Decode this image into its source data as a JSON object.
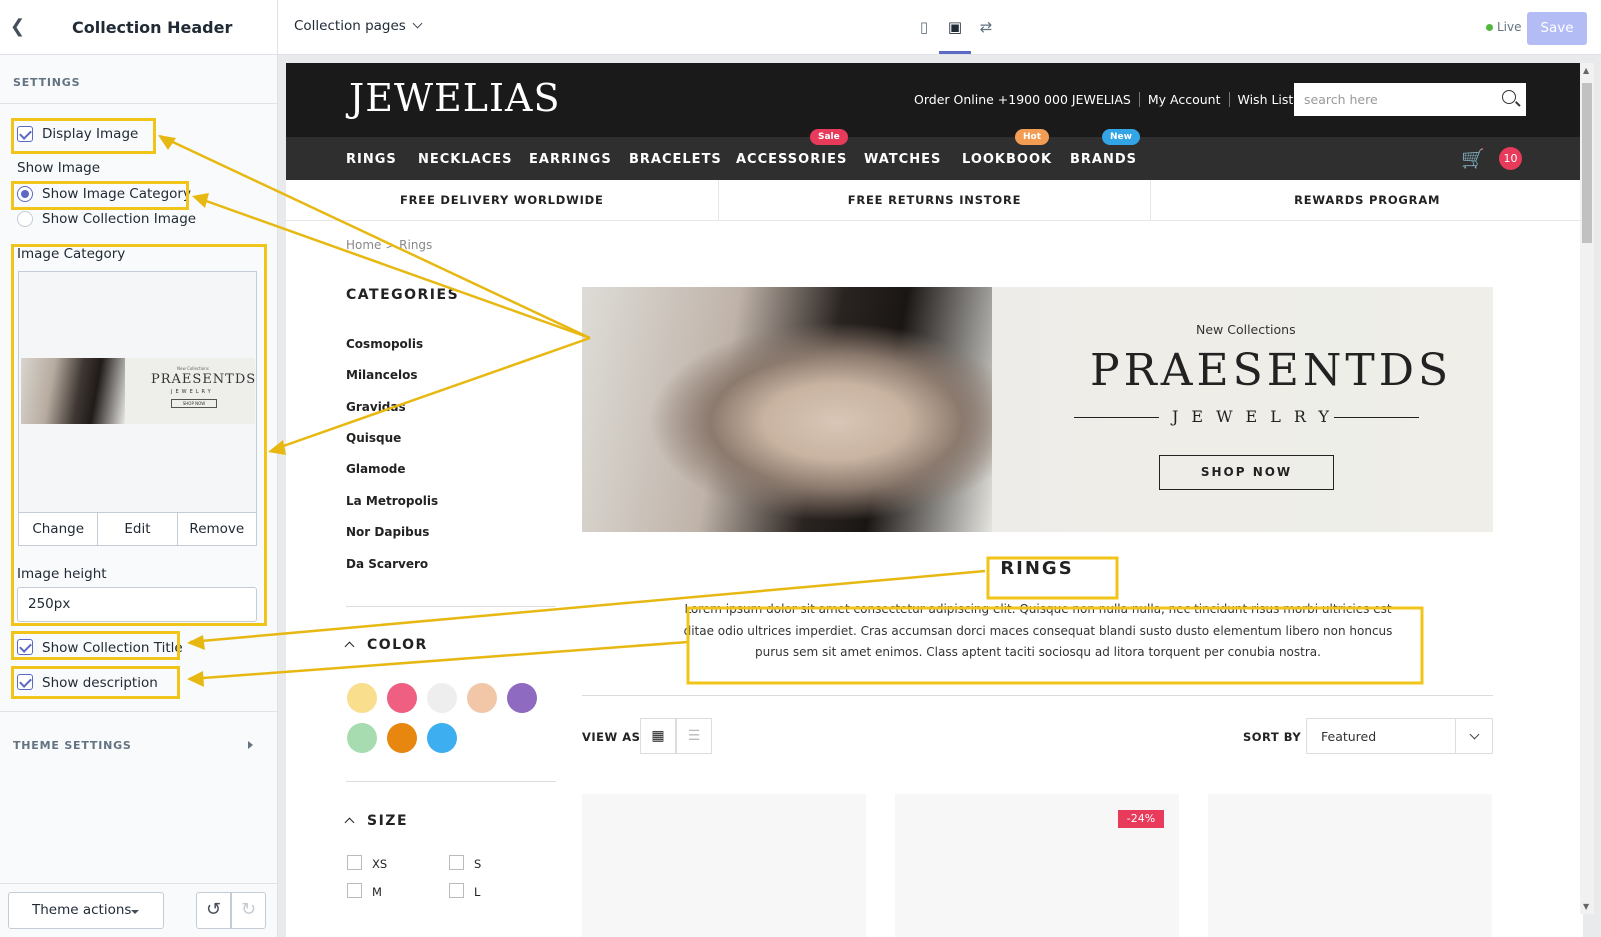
{
  "panel": {
    "title": "Collection Header",
    "settings_label": "SETTINGS",
    "display_image": "Display Image",
    "show_image_label": "Show Image",
    "radio_category": "Show Image Category",
    "radio_collection": "Show Collection Image",
    "image_category_label": "Image Category",
    "thumb": {
      "small": "New Collections",
      "title": "PRAESENTDS",
      "sub": "JEWELRY",
      "btn": "SHOP NOW"
    },
    "buttons": {
      "change": "Change",
      "edit": "Edit",
      "remove": "Remove"
    },
    "image_height_label": "Image height",
    "image_height_value": "250px",
    "show_collection_title": "Show Collection Title",
    "show_description": "Show description",
    "theme_settings": "THEME SETTINGS",
    "theme_actions": "Theme actions"
  },
  "topbar": {
    "pages_select": "Collection pages",
    "live": "Live",
    "save": "Save"
  },
  "store": {
    "logo": "JEWELIAS",
    "top_links": [
      "Order Online +1900 000 JEWELIAS",
      "My Account",
      "Wish Lists"
    ],
    "search_placeholder": "search here",
    "menu": [
      "RINGS",
      "NECKLACES",
      "EARRINGS",
      "BRACELETS",
      "ACCESSORIES",
      "WATCHES",
      "LOOKBOOK",
      "BRANDS"
    ],
    "badges": {
      "sale": "Sale",
      "hot": "Hot",
      "new": "New"
    },
    "badge_colors": {
      "sale": "#e83a5a",
      "hot": "#f39c54",
      "new": "#33a4e6"
    },
    "cart_count": "10",
    "promos": [
      "FREE DELIVERY WORLDWIDE",
      "FREE RETURNS INSTORE",
      "REWARDS PROGRAM"
    ],
    "breadcrumb": {
      "home": "Home",
      "sep": ">",
      "current": "Rings"
    },
    "categories_title": "CATEGORIES",
    "categories": [
      "Cosmopolis",
      "Milancelos",
      "Gravidas",
      "Quisque",
      "Glamode",
      "La Metropolis",
      "Nor Dapibus",
      "Da Scarvero"
    ],
    "color_title": "COLOR",
    "colors": [
      "#f9de8e",
      "#ee5f82",
      "#eeeeee",
      "#f2c7a8",
      "#8e6ac0",
      "#a6dcb0",
      "#e8870f",
      "#3daef0"
    ],
    "size_title": "SIZE",
    "sizes": [
      "XS",
      "S",
      "M",
      "L"
    ],
    "banner": {
      "small": "New Collections",
      "title": "PRAESENTDS",
      "sub": "JEWELRY",
      "button": "SHOP NOW"
    },
    "collection_title": "RINGS",
    "description": "Lorem ipsum dolor sit amet consectetur adipiscing elit. Quisque non nulla nulla, nec tincidunt risus morbi ultricies est ditae odio ultrices imperdiet. Cras accumsan dorci maces consequat blandi susto dusto elementum libero non honcus purus sem sit amet enimos. Class aptent taciti sociosqu ad litora torquent per conubia nostra.",
    "view_as": "VIEW AS",
    "sort_by": "SORT BY",
    "sort_value": "Featured",
    "discount": "-24%"
  },
  "colors": {
    "highlight": "#f0c419",
    "accent": "#5c6ac4"
  }
}
